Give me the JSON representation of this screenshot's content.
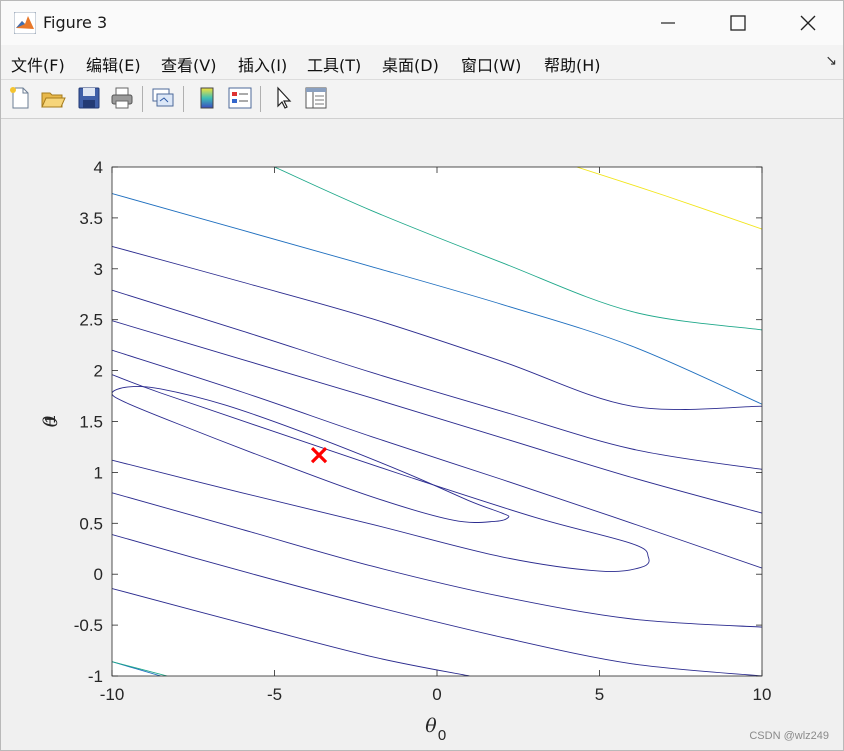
{
  "window": {
    "title": "Figure 3"
  },
  "menu": {
    "items": [
      "文件(F)",
      "编辑(E)",
      "查看(V)",
      "插入(I)",
      "工具(T)",
      "桌面(D)",
      "窗口(W)",
      "帮助(H)"
    ],
    "corner_glyph": "↘"
  },
  "toolbar": {
    "icons": [
      "new-figure-icon",
      "open-file-icon",
      "save-icon",
      "print-icon",
      "link-plot-icon",
      "colorbar-icon",
      "legend-icon",
      "edit-plot-arrow-icon",
      "property-inspector-icon"
    ]
  },
  "watermark": "CSDN @wlz249",
  "chart_data": {
    "type": "contour",
    "xlim": [
      -10,
      10
    ],
    "ylim": [
      -1,
      4
    ],
    "xticks": [
      "-10",
      "-5",
      "0",
      "5",
      "10"
    ],
    "yticks": [
      "-1",
      "-0.5",
      "0",
      "0.5",
      "1",
      "1.5",
      "2",
      "2.5",
      "3",
      "3.5",
      "4"
    ],
    "xlabel": "θ",
    "xlabel_sub": "0",
    "ylabel": "θ",
    "ylabel_sub": "1",
    "grid": false,
    "marker": {
      "x": -3.63,
      "y": 1.17,
      "symbol": "x",
      "color": "#ff0000"
    },
    "contour_colors": {
      "dark": "#2b2b8f",
      "mid": "#1f6fbf",
      "teal": "#1fa88a",
      "yellow": "#f2e51a"
    },
    "contours": [
      {
        "level": 1,
        "color": "dark",
        "closed": true,
        "points": [
          [
            -10,
            1.78
          ],
          [
            -9.5,
            1.84
          ],
          [
            -8.5,
            1.82
          ],
          [
            -6.5,
            1.66
          ],
          [
            -4,
            1.38
          ],
          [
            -1,
            1.0
          ],
          [
            1,
            0.72
          ],
          [
            2,
            0.6
          ],
          [
            2.2,
            0.56
          ],
          [
            1.8,
            0.52
          ],
          [
            0.5,
            0.53
          ],
          [
            -2,
            0.76
          ],
          [
            -5,
            1.11
          ],
          [
            -8,
            1.48
          ],
          [
            -9.6,
            1.69
          ],
          [
            -10,
            1.78
          ]
        ]
      },
      {
        "level": 2,
        "color": "dark",
        "closed": false,
        "points": [
          [
            -10,
            1.12
          ],
          [
            -6,
            0.8
          ],
          [
            -2,
            0.49
          ],
          [
            2,
            0.17
          ],
          [
            5,
            0.03
          ],
          [
            6.3,
            0.07
          ],
          [
            6.5,
            0.17
          ],
          [
            6,
            0.3
          ],
          [
            3,
            0.56
          ],
          [
            -1,
            0.97
          ],
          [
            -5,
            1.4
          ],
          [
            -8.5,
            1.78
          ],
          [
            -10,
            1.96
          ]
        ]
      },
      {
        "level": 3,
        "color": "dark",
        "closed": false,
        "points": [
          [
            -10,
            0.8
          ],
          [
            -6,
            0.44
          ],
          [
            -2,
            0.08
          ],
          [
            2,
            -0.22
          ],
          [
            6,
            -0.44
          ],
          [
            10,
            -0.52
          ]
        ]
      },
      {
        "level": 3,
        "color": "dark",
        "closed": false,
        "points": [
          [
            -10,
            2.2
          ],
          [
            -6,
            1.79
          ],
          [
            -2,
            1.35
          ],
          [
            2,
            0.93
          ],
          [
            6,
            0.5
          ],
          [
            10,
            0.06
          ]
        ]
      },
      {
        "level": 4,
        "color": "dark",
        "closed": false,
        "points": [
          [
            -10,
            0.39
          ],
          [
            -6,
            0.03
          ],
          [
            -2,
            -0.31
          ],
          [
            2,
            -0.62
          ],
          [
            6,
            -0.88
          ],
          [
            10,
            -1.0
          ]
        ]
      },
      {
        "level": 4,
        "color": "dark",
        "closed": false,
        "points": [
          [
            -10,
            2.49
          ],
          [
            -6,
            2.11
          ],
          [
            -2,
            1.73
          ],
          [
            2,
            1.34
          ],
          [
            6,
            0.95
          ],
          [
            10,
            0.6
          ]
        ]
      },
      {
        "level": 5,
        "color": "dark",
        "closed": false,
        "points": [
          [
            -10,
            2.79
          ],
          [
            -6,
            2.39
          ],
          [
            -2,
            1.98
          ],
          [
            2,
            1.6
          ],
          [
            6,
            1.23
          ],
          [
            10,
            1.03
          ]
        ]
      },
      {
        "level": 6,
        "color": "dark",
        "closed": false,
        "points": [
          [
            -10,
            3.22
          ],
          [
            -6,
            2.87
          ],
          [
            -2,
            2.51
          ],
          [
            2,
            2.09
          ],
          [
            6,
            1.65
          ],
          [
            10,
            1.65
          ]
        ]
      },
      {
        "level": 6,
        "color": "dark",
        "closed": false,
        "points": [
          [
            -10,
            -0.14
          ],
          [
            -6,
            -0.48
          ],
          [
            -2,
            -0.81
          ],
          [
            1,
            -1.0
          ]
        ]
      },
      {
        "level": 7,
        "color": "mid",
        "closed": false,
        "points": [
          [
            -10,
            3.74
          ],
          [
            -6,
            3.38
          ],
          [
            -2,
            3.02
          ],
          [
            2,
            2.65
          ],
          [
            6,
            2.24
          ],
          [
            10,
            1.67
          ]
        ]
      },
      {
        "level": 7,
        "color": "mid",
        "closed": false,
        "points": [
          [
            -10,
            -0.86
          ],
          [
            -8.5,
            -1.0
          ]
        ]
      },
      {
        "level": 8,
        "color": "teal",
        "closed": false,
        "points": [
          [
            -5,
            4.0
          ],
          [
            -2,
            3.57
          ],
          [
            2,
            3.06
          ],
          [
            6,
            2.58
          ],
          [
            10,
            2.4
          ]
        ]
      },
      {
        "level": 8,
        "color": "teal",
        "closed": false,
        "points": [
          [
            -10,
            -0.86
          ],
          [
            -8.3,
            -1.0
          ]
        ]
      },
      {
        "level": 9,
        "color": "yellow",
        "closed": false,
        "points": [
          [
            4.3,
            4.0
          ],
          [
            7,
            3.72
          ],
          [
            10,
            3.39
          ]
        ]
      }
    ]
  }
}
